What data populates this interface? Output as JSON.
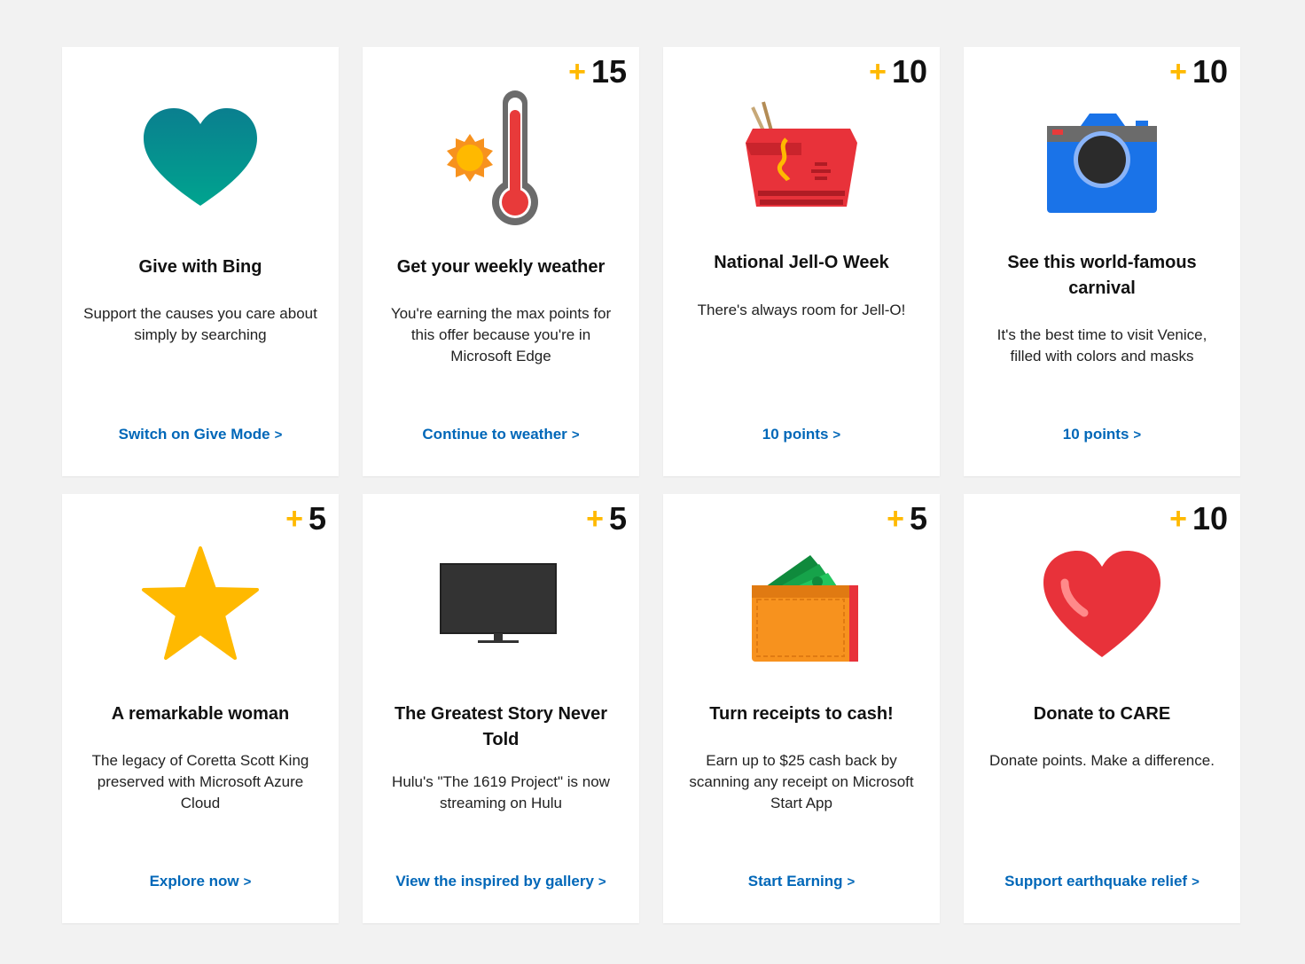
{
  "colors": {
    "background": "#f2f2f2",
    "card": "#ffffff",
    "link": "#0067b8",
    "plus": "#ffb900"
  },
  "plus_symbol": "+",
  "link_chevron": ">",
  "cards": [
    {
      "icon": "teal-heart-icon",
      "points": "",
      "title": "Give with Bing",
      "description": "Support the causes you care about simply by searching",
      "link": "Switch on Give Mode"
    },
    {
      "icon": "thermometer-sun-icon",
      "points": "15",
      "title": "Get your weekly weather",
      "description": "You're earning the max points for this offer because you're in Microsoft Edge",
      "link": "Continue to weather"
    },
    {
      "icon": "takeout-box-icon",
      "points": "10",
      "title": "National Jell-O Week",
      "description": "There's always room for Jell-O!",
      "link": "10 points"
    },
    {
      "icon": "camera-icon",
      "points": "10",
      "title": "See this world-famous carnival",
      "description": "It's the best time to visit Venice, filled with colors and masks",
      "link": "10 points"
    },
    {
      "icon": "star-icon",
      "points": "5",
      "title": "A remarkable woman",
      "description": "The legacy of Coretta Scott King preserved with Microsoft Azure Cloud",
      "link": "Explore now"
    },
    {
      "icon": "tv-icon",
      "points": "5",
      "title": "The Greatest Story Never Told",
      "description": "Hulu's \"The 1619 Project\" is now streaming on Hulu",
      "link": "View the inspired by gallery"
    },
    {
      "icon": "wallet-cash-icon",
      "points": "5",
      "title": "Turn receipts to cash!",
      "description": "Earn up to $25 cash back by scanning any receipt on Microsoft Start App",
      "link": "Start Earning"
    },
    {
      "icon": "red-heart-icon",
      "points": "10",
      "title": "Donate to CARE",
      "description": "Donate points. Make a difference.",
      "link": "Support earthquake relief"
    }
  ]
}
